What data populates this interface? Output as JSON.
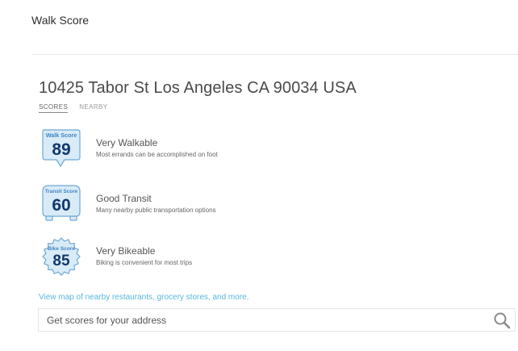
{
  "header": {
    "title": "Walk Score"
  },
  "location": {
    "address": "10425 Tabor St Los Angeles CA 90034 USA"
  },
  "tabs": [
    {
      "label": "SCORES",
      "active": true
    },
    {
      "label": "NEARBY",
      "active": false
    }
  ],
  "scores": {
    "walk": {
      "badge_label": "Walk Score",
      "value": "89",
      "title": "Very Walkable",
      "description": "Most errands can be accomplished on foot"
    },
    "transit": {
      "badge_label": "Transit Score",
      "value": "60",
      "title": "Good Transit",
      "description": "Many nearby public transportation options"
    },
    "bike": {
      "badge_label": "Bike Score",
      "value": "85",
      "title": "Very Bikeable",
      "description": "Biking is convenient for most trips"
    }
  },
  "links": {
    "map": "View map of nearby restaurants, grocery stores, and more."
  },
  "search": {
    "placeholder": "Get scores for your address",
    "icon": "search-icon"
  },
  "colors": {
    "badge_fill": "#d8ebf7",
    "badge_stroke": "#6fa8d3",
    "badge_header": "#3f86c6",
    "score_number": "#12386b",
    "link": "#57b7dd"
  }
}
